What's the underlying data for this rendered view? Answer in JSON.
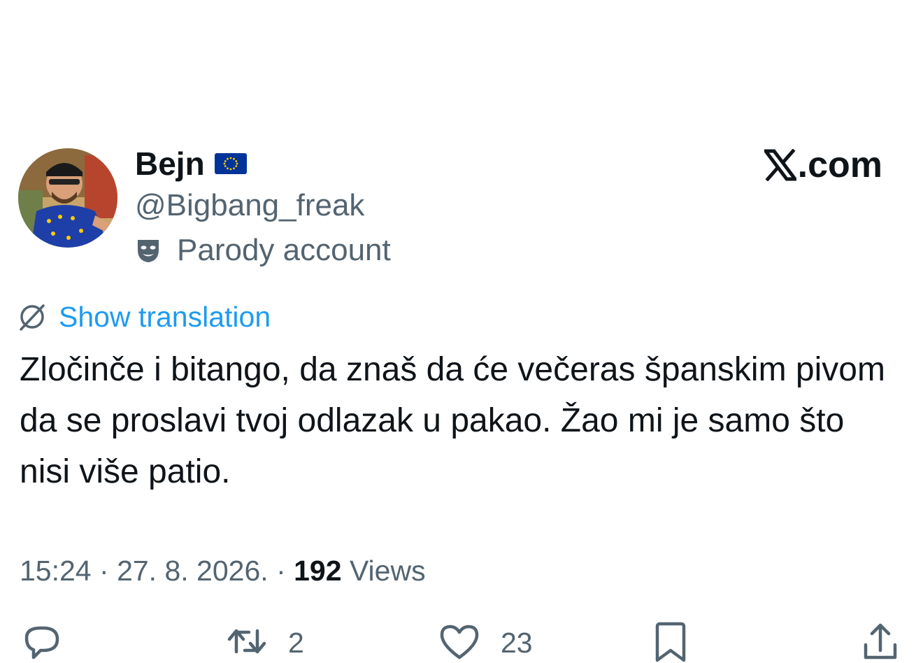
{
  "author": {
    "display_name": "Bejn",
    "handle": "@Bigbang_freak",
    "label": "Parody account",
    "flag_icon": "eu-flag-icon",
    "label_icon": "parody-mask-icon"
  },
  "brand": {
    "site": ".com",
    "logo_icon": "x-logo-icon"
  },
  "translate": {
    "label": "Show translation",
    "icon": "globe-icon"
  },
  "tweet": {
    "text": "Zločinče i bitango, da znaš da će večeras španskim pivom da se proslavi tvoj odlazak u pakao. Žao mi je samo što nisi više patio."
  },
  "meta": {
    "time": "15:24",
    "separator": "·",
    "date": "27. 8. 2026.",
    "views_count": "192",
    "views_label": "Views"
  },
  "actions": {
    "reply_icon": "reply-icon",
    "retweet_icon": "retweet-icon",
    "retweet_count": "2",
    "like_icon": "heart-icon",
    "like_count": "23",
    "bookmark_icon": "bookmark-icon",
    "share_icon": "share-icon"
  },
  "colors": {
    "link": "#1d9bf0",
    "secondary_text": "#536471",
    "primary_text": "#0f1419",
    "eu_blue": "#003399",
    "eu_gold": "#ffcc00"
  }
}
